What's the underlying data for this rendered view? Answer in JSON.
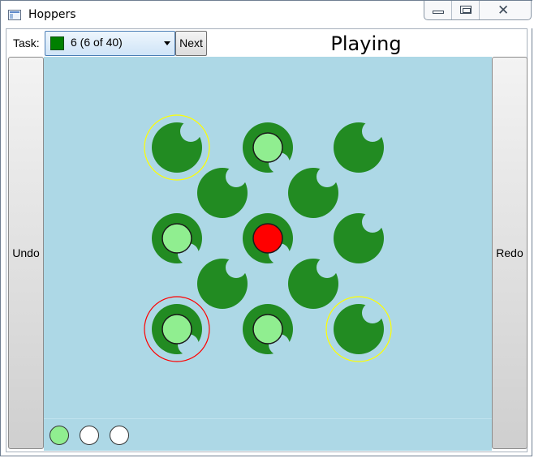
{
  "window": {
    "title": "Hoppers",
    "icon": "app-window-icon",
    "controls": [
      "minimize-icon",
      "maximize-icon",
      "close-icon"
    ]
  },
  "toolbar": {
    "task_label": "Task:",
    "task_value": "6 (6 of 40)",
    "task_swatch_color": "#008000",
    "next_label": "Next"
  },
  "status": "Playing",
  "undo_label": "Undo",
  "redo_label": "Redo",
  "colors": {
    "board": "#add8e6",
    "lily_pad": "#228b22",
    "green_frog": "#90ee90",
    "red_frog": "#ff0000",
    "selected_ring": "#ff0000",
    "target_ring": "#ffff00"
  },
  "board": {
    "pads": [
      {
        "row": 0,
        "col": 0,
        "frog": null,
        "ring": "target"
      },
      {
        "row": 0,
        "col": 2,
        "frog": "green",
        "ring": null
      },
      {
        "row": 0,
        "col": 4,
        "frog": null,
        "ring": null
      },
      {
        "row": 1,
        "col": 1,
        "frog": null,
        "ring": null
      },
      {
        "row": 1,
        "col": 3,
        "frog": null,
        "ring": null
      },
      {
        "row": 2,
        "col": 0,
        "frog": "green",
        "ring": null
      },
      {
        "row": 2,
        "col": 2,
        "frog": "red",
        "ring": null
      },
      {
        "row": 2,
        "col": 4,
        "frog": null,
        "ring": null
      },
      {
        "row": 3,
        "col": 1,
        "frog": null,
        "ring": null
      },
      {
        "row": 3,
        "col": 3,
        "frog": null,
        "ring": null
      },
      {
        "row": 4,
        "col": 0,
        "frog": "green",
        "ring": "selected"
      },
      {
        "row": 4,
        "col": 2,
        "frog": "green",
        "ring": null
      },
      {
        "row": 4,
        "col": 4,
        "frog": null,
        "ring": "target"
      }
    ]
  },
  "tray": {
    "slots": [
      "filled",
      "empty",
      "empty"
    ]
  }
}
